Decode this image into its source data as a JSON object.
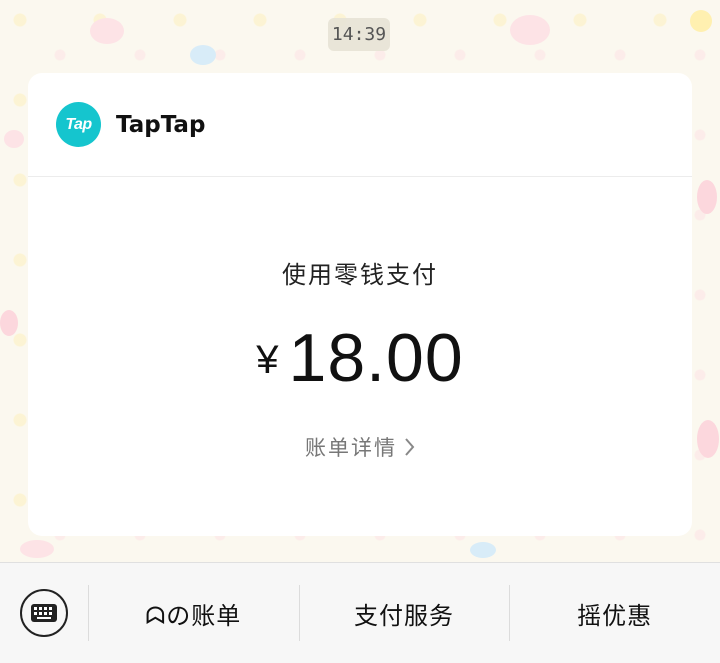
{
  "timestamp": "14:39",
  "merchant": {
    "logo_text": "Tap",
    "name": "TapTap"
  },
  "payment": {
    "method": "使用零钱支付",
    "currency_symbol": "¥",
    "amount": "18.00",
    "detail_link": "账单详情"
  },
  "menu": {
    "keyboard_icon": "keyboard-icon",
    "items": [
      {
        "label": "ᗣの账单"
      },
      {
        "label": "支付服务"
      },
      {
        "label": "摇优惠"
      }
    ]
  },
  "colors": {
    "logo_bg": "#15c5ce",
    "card_bg": "#ffffff",
    "bar_bg": "#f7f7f7"
  }
}
